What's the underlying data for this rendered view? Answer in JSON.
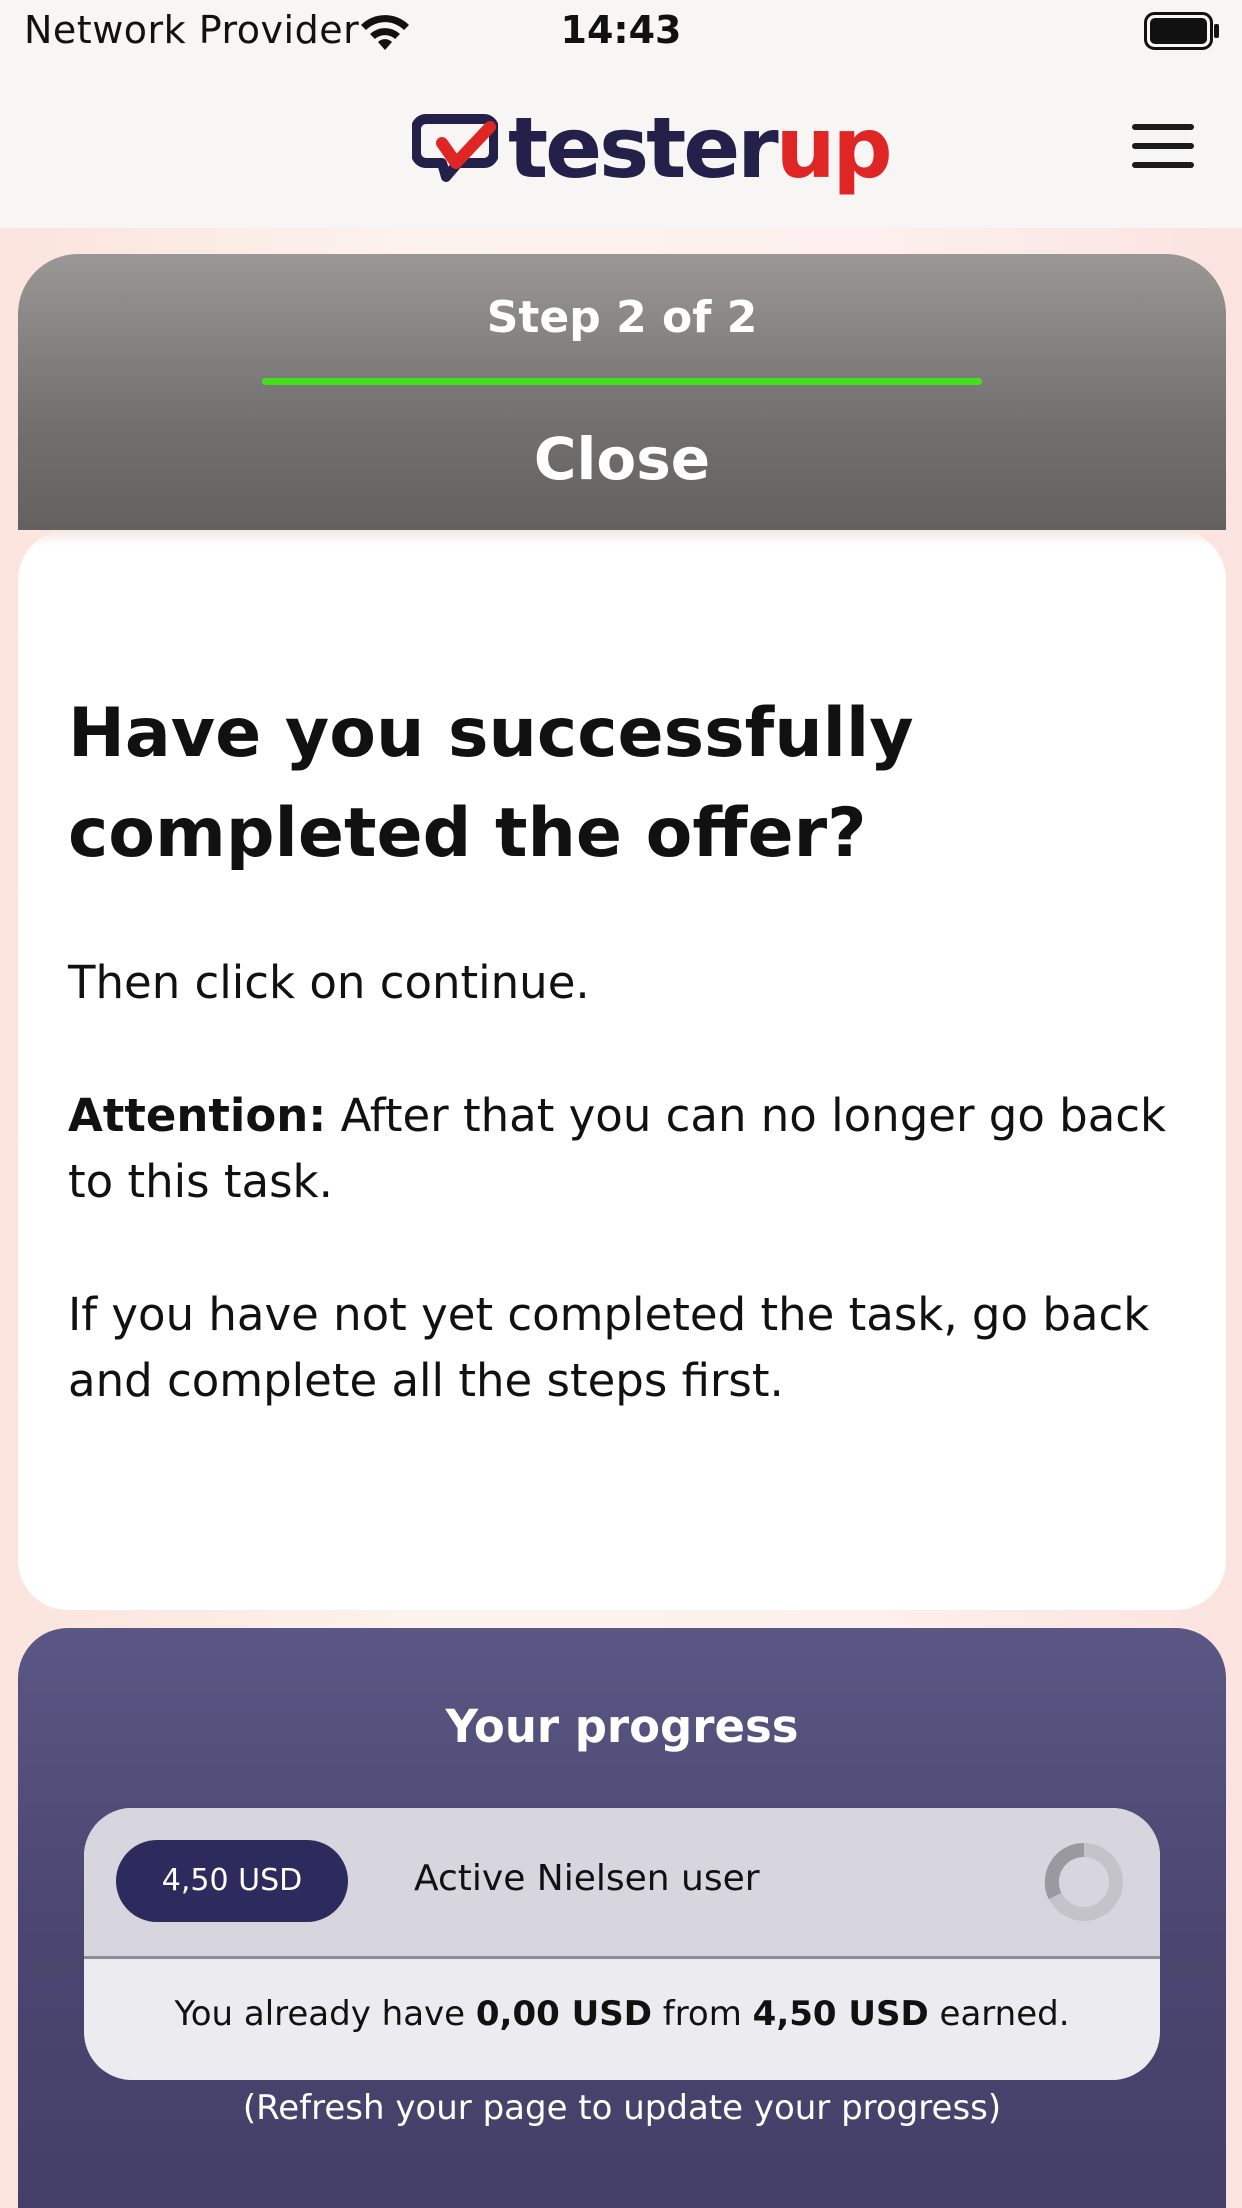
{
  "status_bar": {
    "carrier": "Network Provider",
    "time": "14:43"
  },
  "header": {
    "logo_part1": "tester",
    "logo_part2": "up",
    "menu_icon": "hamburger-menu-icon"
  },
  "step_panel": {
    "step_label": "Step 2 of 2",
    "progress_fraction": 1.0,
    "close_label": "Close"
  },
  "question": {
    "title": "Have you successfully completed the offer?",
    "instruction": "Then click on continue.",
    "attention_label": "Attention:",
    "attention_text": " After that you can no longer go back to this task.",
    "note": "If you have not yet completed the task, go back and complete all the steps first."
  },
  "progress": {
    "title": "Your progress",
    "reward": "4,50 USD",
    "task_name": "Active Nielsen user",
    "earned_prefix": "You already have ",
    "earned_amount": "0,00 USD",
    "earned_middle": " from ",
    "earned_total": "4,50 USD",
    "earned_suffix": " earned.",
    "refresh_note": "(Refresh your page to update your progress)"
  },
  "colors": {
    "brand_dark": "#23204a",
    "brand_red": "#e02624",
    "step_progress": "#44e01a",
    "progress_panel": "#4b4772",
    "pill": "#2d2a5e"
  }
}
